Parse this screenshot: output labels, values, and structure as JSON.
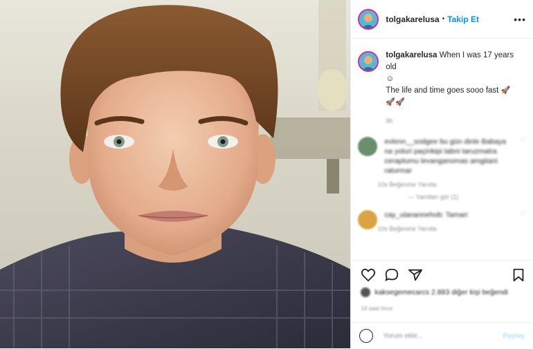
{
  "post": {
    "username": "tolgakarelusa",
    "separator": "•",
    "follow_label": "Takip Et",
    "more_label": "•••",
    "caption_username": "tolgakarelusa",
    "caption_line1": "When I was 17 years old",
    "caption_emoji1": "☺",
    "caption_line2": "The life and time goes sooo fast",
    "caption_rockets_inline": "🚀",
    "caption_rockets_line3": "🚀🚀",
    "caption_meta": "9h"
  },
  "comments": [
    {
      "text": "evlenn__sodgee bu gün dinle Babaya na yoluri paçinkipi tabni taruzmatra ceraptumu levanganomas amgitani raturmar",
      "meta": "10s   Beğenme   Yanıtla",
      "replies": "— Yanıtları gör (1)",
      "avatar_color": "#6b8e6b"
    },
    {
      "text": "cay_ulanannehob: Tamari",
      "meta": "10s   Beğenme   Yanıtla",
      "replies": "",
      "avatar_color": "#d9a441"
    }
  ],
  "likes": {
    "text": "kaksegemecarcs 2.883 diğer kişi beğendi"
  },
  "date": "14 saat önce",
  "add_comment": {
    "placeholder": "Yorum ekle...",
    "post_label": "Paylaş"
  },
  "icons": [
    "heart-icon",
    "comment-icon",
    "share-icon",
    "bookmark-icon",
    "emoji-icon",
    "more-icon"
  ]
}
